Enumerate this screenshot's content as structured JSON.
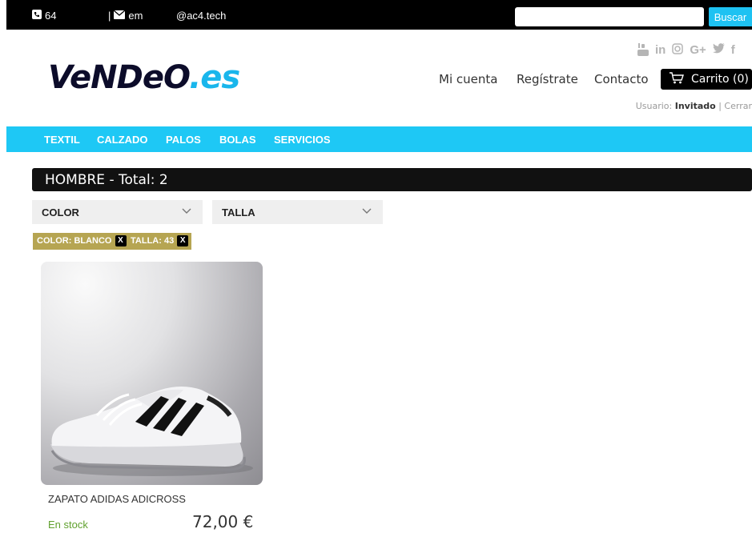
{
  "topbar": {
    "phone": "64",
    "email_partial": "em",
    "email_domain": "@ac4.tech",
    "search_placeholder": "",
    "search_button": "Buscar"
  },
  "header": {
    "logo_main": "VeNDeO",
    "logo_suffix": ".es",
    "social_icons": [
      "youtube-icon",
      "linkedin-icon",
      "instagram-icon",
      "google-plus-icon",
      "twitter-icon",
      "facebook-icon"
    ],
    "nav": [
      "Mi cuenta",
      "Regístrate",
      "Contacto"
    ],
    "cart_label": "Carrito (0)",
    "user_prefix": "Usuario: ",
    "user_name": "Invitado",
    "user_sep": " | ",
    "logout": "Cerrar"
  },
  "categories": [
    "TEXTIL",
    "CALZADO",
    "PALOS",
    "BOLAS",
    "SERVICIOS"
  ],
  "listing": {
    "title": "HOMBRE - Total: 2",
    "filters": [
      "COLOR",
      "TALLA"
    ],
    "active_filters": [
      "COLOR: BLANCO",
      "TALLA: 43"
    ],
    "remove_symbol": "X"
  },
  "products": [
    {
      "name": "ZAPATO ADIDAS ADICROSS",
      "stock": "En stock",
      "price": "72,00 €"
    }
  ],
  "colors": {
    "accent": "#1ec8f5",
    "chip": "#b6a552",
    "stock": "#60a12e"
  }
}
